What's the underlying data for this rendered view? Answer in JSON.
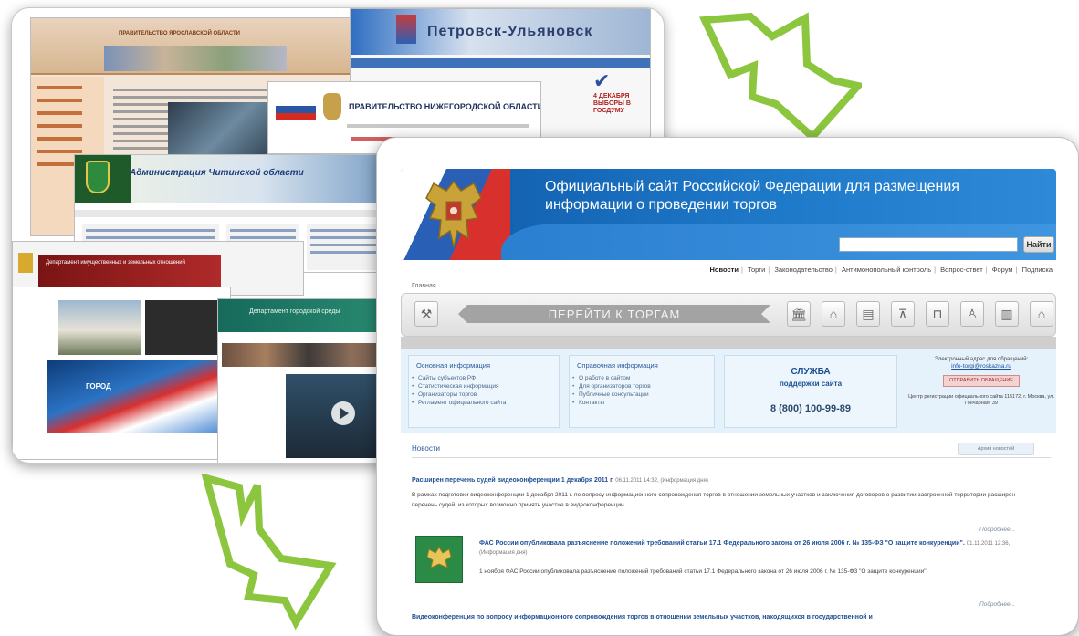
{
  "collage": {
    "s1_title": "ПРАВИТЕЛЬСТВО ЯРОСЛАВСКОЙ ОБЛАСТИ",
    "s2_title": "Петровск-Ульяновск",
    "s2_vote": "4 ДЕКАБРЯ ВЫБОРЫ В ГОСДУМУ",
    "s3_title": "ПРАВИТЕЛЬСТВО НИЖЕГОРОДСКОЙ ОБЛАСТИ",
    "s4_title": "Администрация Читинской области",
    "s5_red_text": "Департамент имущественных и земельных отношений",
    "s6_wave_text": "ГОРОД",
    "s7_title": "Департамент городской среды"
  },
  "site": {
    "title_line1": "Официальный сайт Российской Федерации для размещения",
    "title_line2": "информации о проведении торгов",
    "search_placeholder": "",
    "search_button": "Найти"
  },
  "topnav": {
    "items": [
      "Новости",
      "Торги",
      "Законодательство",
      "Антимонопольный контроль",
      "Вопрос-ответ",
      "Форум",
      "Подписка"
    ]
  },
  "breadcrumb": "Главная",
  "goto_label": "ПЕРЕЙТИ К ТОРГАМ",
  "info": {
    "basic_title": "Основная информация",
    "basic_items": [
      "Сайты субъектов РФ",
      "Статистическая информация",
      "Организаторы торгов",
      "Регламент официального сайта"
    ],
    "ref_title": "Справочная информация",
    "ref_items": [
      "О работе в сайтом",
      "Для организаторов торгов",
      "Публичные консультации",
      "Контакты"
    ],
    "support_title": "СЛУЖБА",
    "support_sub": "поддержки сайта",
    "support_phone": "8 (800) 100-99-89",
    "email_label": "Электронный адрес для обращений:",
    "email": "info-torgi@roskazna.ru",
    "send_button": "ОТПРАВИТЬ ОБРАЩЕНИЕ",
    "address": "Центр регистрации официального сайта 115172, г. Москва, ул. Гончарная, 39"
  },
  "news": {
    "header": "Новости",
    "archive_button": "Архив новостей",
    "item1_title": "Расширен перечень судей видеоконференции 1 декабря 2011 г.",
    "item1_meta": "06.11.2011 14:32, (Информация дня)",
    "item1_text": "В рамках подготовки видеоконференции 1 декабря 2011 г. по вопросу информационного сопровождения торгов в отношении земельных участков и заключения договоров о развитии застроенной территории расширен перечень судей, из которых возможно принять участие в видеоконференции.",
    "item2_title": "ФАС России опубликовала разъяснение положений требований статьи 17.1 Федерального закона от 26 июля 2006 г. № 135-ФЗ \"О защите конкуренции\".",
    "item2_meta": "01.11.2011 12:36, (Информация дня)",
    "item2_text": "1 ноября ФАС России опубликовала разъяснение положений требований статьи 17.1 Федерального закона от 26 июля 2006 г. № 135-ФЗ \"О защите конкуренции\"",
    "item3_title": "Видеоконференция по вопросу информационного сопровождения торгов в отношении земельных участков, находящихся в государственной и",
    "more": "Подробнее..."
  },
  "colors": {
    "arrow": "#8cc63f",
    "header_blue": "#1e78c8",
    "link_blue": "#1f4f95"
  },
  "icons": [
    "hammer-icon",
    "bank-icon",
    "factory-icon",
    "truck-icon",
    "tower-icon",
    "building-icon",
    "person-icon",
    "city-icon",
    "house-icon"
  ]
}
